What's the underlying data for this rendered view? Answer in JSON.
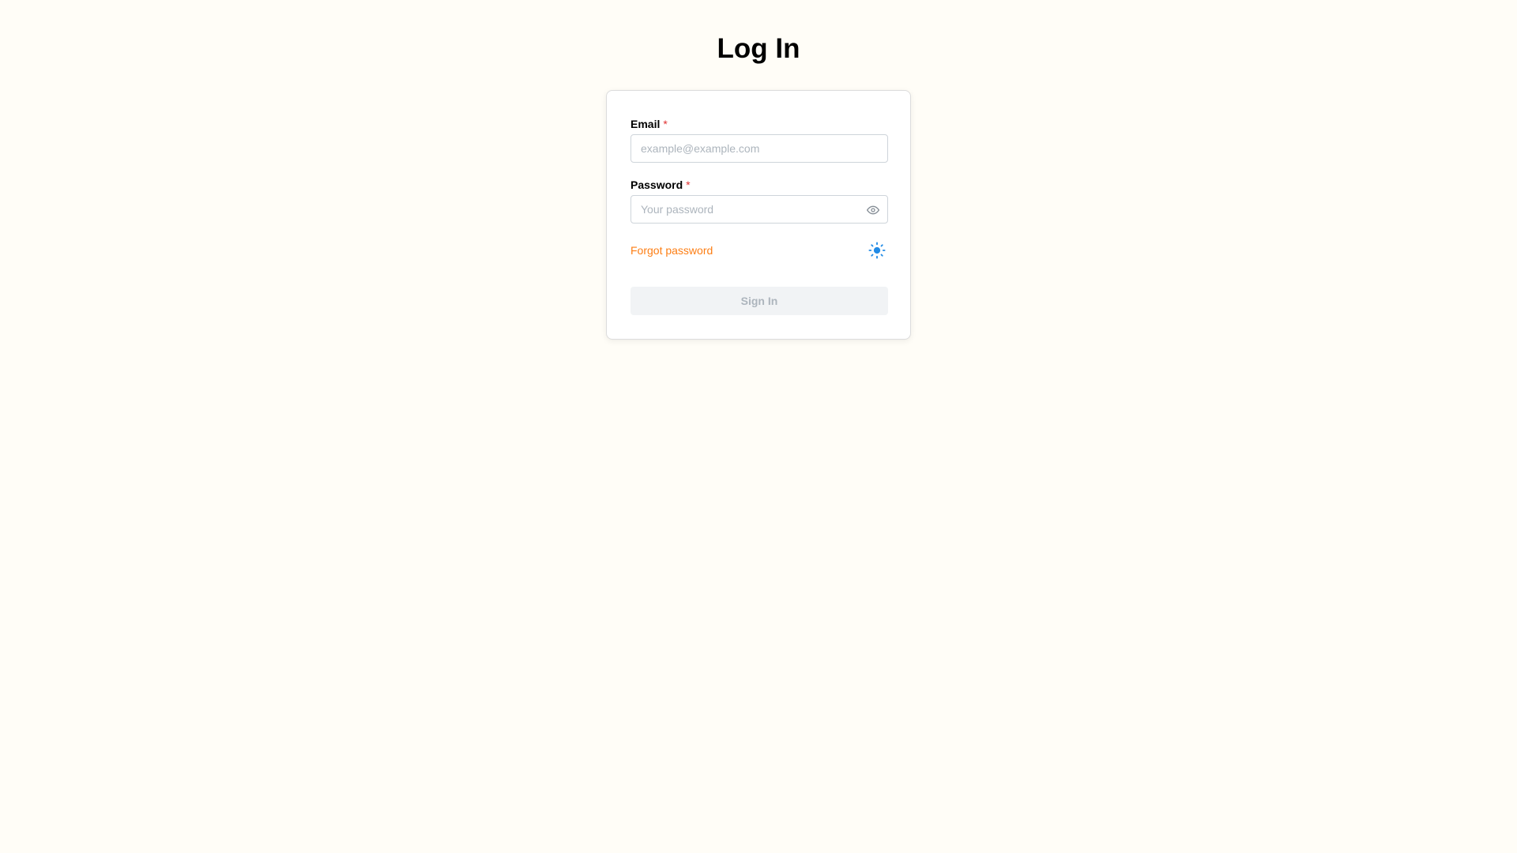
{
  "page": {
    "title": "Log In"
  },
  "form": {
    "email_label": "Email",
    "email_required_mark": "*",
    "email_placeholder": "example@example.com",
    "email_value": "",
    "password_label": "Password",
    "password_required_mark": "*",
    "password_placeholder": "Your password",
    "password_value": "",
    "forgot_password_label": "Forgot password",
    "sign_in_label": "Sign In"
  },
  "icons": {
    "password_toggle": "eye-icon",
    "theme_toggle": "sun-icon"
  },
  "colors": {
    "background": "#fffdf7",
    "required_mark": "#e03131",
    "link": "#fd7e14",
    "theme_icon": "#228be6",
    "button_disabled_bg": "#f1f3f5",
    "button_disabled_text": "#adb5bd"
  }
}
